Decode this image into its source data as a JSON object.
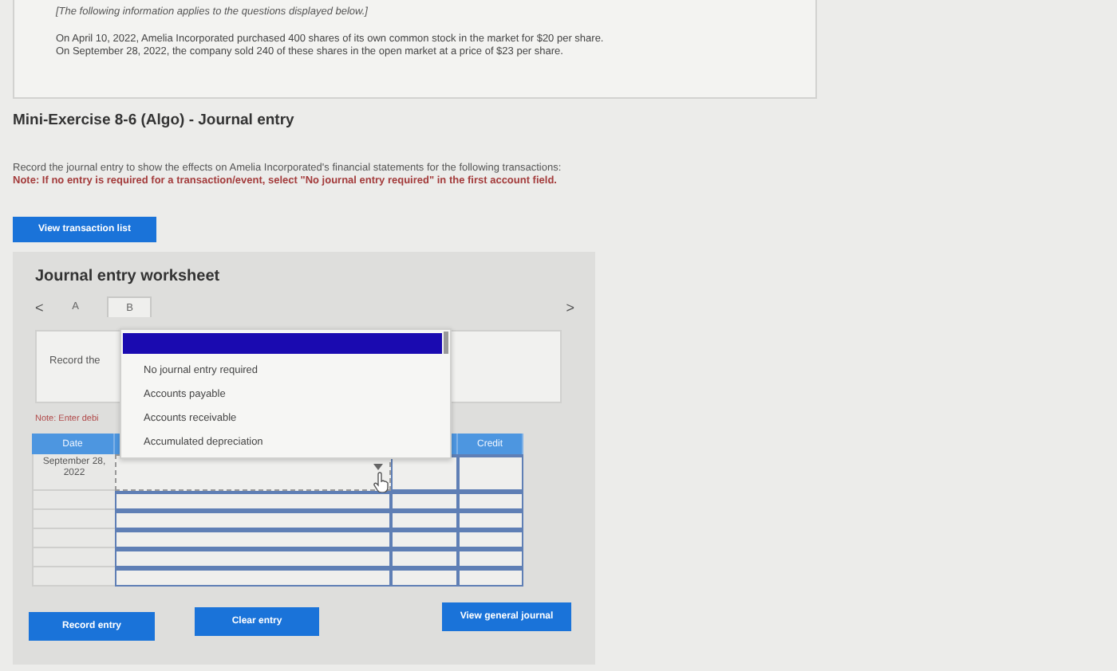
{
  "info": {
    "heading": "[The following information applies to the questions displayed below.]",
    "lines": [
      "On April 10, 2022, Amelia Incorporated purchased 400 shares of its own common stock in the market for $20 per share.",
      "On September 28, 2022, the company sold 240 of these shares in the open market at a price of $23 per share."
    ]
  },
  "title": "Mini-Exercise 8-6 (Algo) - Journal entry",
  "instruction": "Record the journal entry to show the effects on Amelia Incorporated's financial statements for the following transactions:",
  "note": "Note: If no entry is required for a transaction/event, select \"No journal entry required\" in the first account field.",
  "transaction_button": "View transaction list",
  "worksheet": {
    "title": "Journal entry worksheet",
    "prev": "<",
    "next": ">",
    "tabs": [
      {
        "label": "A",
        "selected": false
      },
      {
        "label": "B",
        "selected": true
      }
    ],
    "description": "Record the",
    "hint": "Note: Enter debi",
    "table": {
      "header": {
        "date": "Date",
        "credit": "Credit"
      },
      "rows": [
        {
          "date": "September 28, 2022",
          "kind": "dropdown"
        },
        {
          "kind": "blank"
        },
        {
          "kind": "blank"
        },
        {
          "kind": "blank"
        },
        {
          "kind": "blank"
        },
        {
          "kind": "blank"
        }
      ]
    },
    "dropdown": {
      "options": [
        {
          "selected": true
        },
        {
          "label": "No journal entry required",
          "selected": false
        },
        {
          "label": "Accounts payable",
          "selected": false
        },
        {
          "label": "Accounts receivable",
          "selected": false
        },
        {
          "label": "Accumulated depreciation",
          "selected": false
        }
      ]
    },
    "buttons": [
      "Record entry",
      "Clear entry",
      "View general journal"
    ]
  }
}
